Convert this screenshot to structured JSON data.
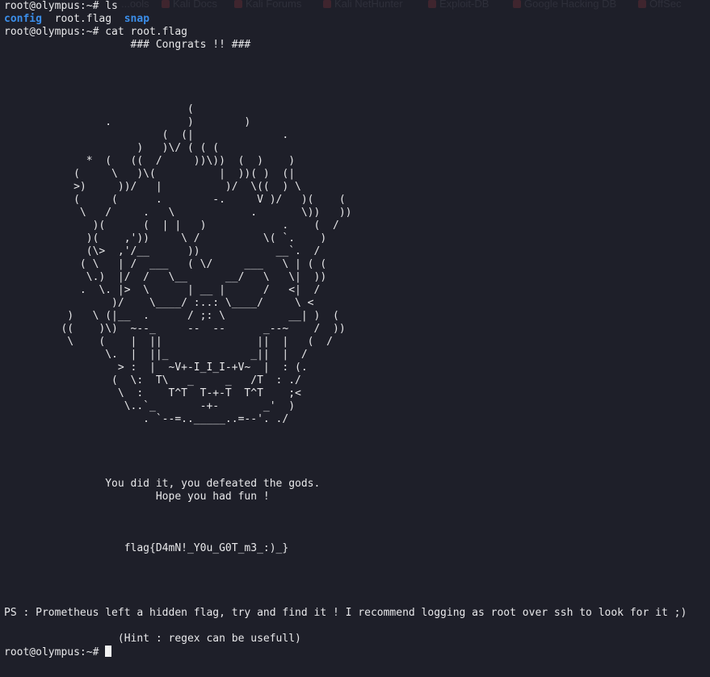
{
  "bookmarks_bar": {
    "items": [
      "...ools",
      "Kali Docs",
      "Kali Forums",
      "Kali NetHunter",
      "Exploit-DB",
      "Google Hacking DB",
      "OffSec"
    ]
  },
  "terminal": {
    "prompt": "root@olympus:~#",
    "cmd_ls": "ls",
    "ls_output": {
      "config": "config",
      "root_flag": "root.flag",
      "snap": "snap"
    },
    "cmd_cat": "cat root.flag",
    "banner": "                    ### Congrats !! ###",
    "ascii_art": "                             (\n                .            )        )\n                         (  (|              .\n                     )   )\\/ ( ( (\n             *  (   ((  /     ))\\))  (  )    )\n           (     \\   )\\(          |  ))( )  (|\n           >)     ))/   |          )/  \\((  ) \\\n           (     (      .        -.     V )/   )(    (\n            \\   /     .   \\            .       \\))   ))\n              )(      (  | |   )            .    (  /\n             )(    ,'))     \\ /          \\( `.    )\n             (\\>  ,'/__      ))            __`.  /\n            ( \\   | /  ___   ( \\/     ___   \\ | ( (\n             \\.)  |/  /   \\__      __/   \\   \\|  ))\n            .  \\. |>  \\      | __ |      /   <|  /\n                 )/    \\____/ :..: \\____/     \\ <\n          )   \\ (|__  .      / ;: \\          __| )  (\n         ((    )\\)  ~--_     --  --      _--~    /  ))\n          \\    (    |  ||               ||  |   (  /\n                \\.  |  ||_             _||  |  /\n                  > :  |  ~V+-I_I_I-+V~  |  : (.\n                 (  \\:  T\\   _     _   /T  : ./\n                  \\  :    T^T  T-+-T  T^T    ;<\n                   \\..`_       -+-       _'  )\n                      . `--=.._____..=--'. ./",
    "message_line1": "                You did it, you defeated the gods.",
    "message_line2": "                        Hope you had fun !",
    "flag": "                   flag{D4mN!_Y0u_G0T_m3_:)_}",
    "ps_note": "PS : Prometheus left a hidden flag, try and find it ! I recommend logging as root over ssh to look for it ;)",
    "hint": "                  (Hint : regex can be usefull)"
  },
  "colors": {
    "background": "#1e1f29",
    "text": "#e8e8ea",
    "directory": "#3b8eea",
    "cursor": "#f2f2f2"
  }
}
